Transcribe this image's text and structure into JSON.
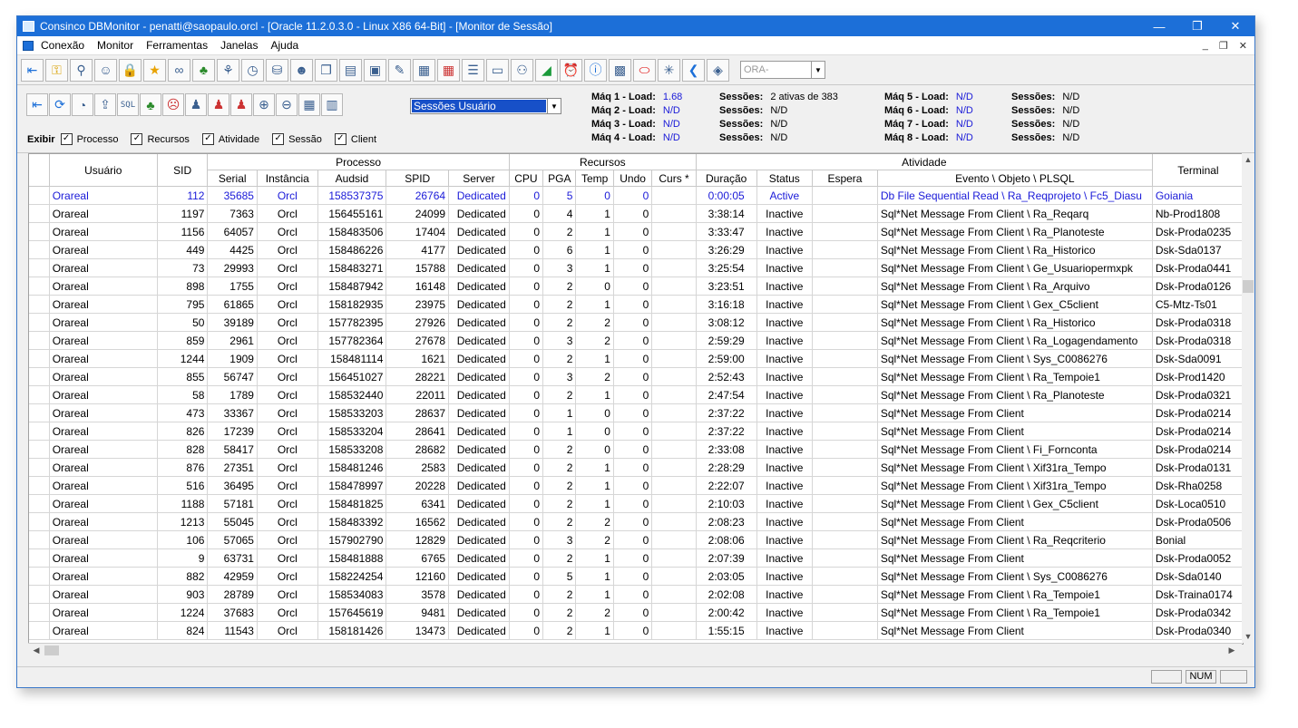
{
  "window": {
    "title": "Consinco DBMonitor - penatti@saopaulo.orcl - [Oracle 11.2.0.3.0 - Linux X86 64-Bit] - [Monitor de Sessão]"
  },
  "menu": [
    "Conexão",
    "Monitor",
    "Ferramentas",
    "Janelas",
    "Ajuda"
  ],
  "ora_combo": {
    "value": "ORA-"
  },
  "session_combo": {
    "value": "Sessões Usuário"
  },
  "exibir": {
    "label": "Exibir",
    "options": [
      "Processo",
      "Recursos",
      "Atividade",
      "Sessão",
      "Client"
    ]
  },
  "machines": [
    {
      "label": "Máq 1 - Load:",
      "value": "1.68",
      "sess_label": "Sessões:",
      "sess_value": "2 ativas de 383"
    },
    {
      "label": "Máq 2 - Load:",
      "value": "N/D",
      "sess_label": "Sessões:",
      "sess_value": "N/D"
    },
    {
      "label": "Máq 3 - Load:",
      "value": "N/D",
      "sess_label": "Sessões:",
      "sess_value": "N/D"
    },
    {
      "label": "Máq 4 - Load:",
      "value": "N/D",
      "sess_label": "Sessões:",
      "sess_value": "N/D"
    },
    {
      "label": "Máq 5 - Load:",
      "value": "N/D",
      "sess_label": "Sessões:",
      "sess_value": "N/D"
    },
    {
      "label": "Máq 6 - Load:",
      "value": "N/D",
      "sess_label": "Sessões:",
      "sess_value": "N/D"
    },
    {
      "label": "Máq 7 - Load:",
      "value": "N/D",
      "sess_label": "Sessões:",
      "sess_value": "N/D"
    },
    {
      "label": "Máq 8 - Load:",
      "value": "N/D",
      "sess_label": "Sessões:",
      "sess_value": "N/D"
    }
  ],
  "groups": {
    "processo": "Processo",
    "recursos": "Recursos",
    "atividade": "Atividade"
  },
  "columns": [
    "Usuário",
    "SID",
    "Serial",
    "Instância",
    "Audsid",
    "SPID",
    "Server",
    "CPU",
    "PGA",
    "Temp",
    "Undo",
    "Curs *",
    "Duração",
    "Status",
    "Espera",
    "Evento \\ Objeto \\ PLSQL",
    "Terminal"
  ],
  "rows": [
    [
      "Orareal",
      "112",
      "35685",
      "Orcl",
      "158537375",
      "26764",
      "Dedicated",
      "0",
      "5",
      "0",
      "0",
      "",
      "0:00:05",
      "Active",
      "",
      "Db File Sequential Read \\ Ra_Reqprojeto \\ Fc5_Diasu",
      "Goiania"
    ],
    [
      "Orareal",
      "1197",
      "7363",
      "Orcl",
      "156455161",
      "24099",
      "Dedicated",
      "0",
      "4",
      "1",
      "0",
      "",
      "3:38:14",
      "Inactive",
      "",
      "Sql*Net Message From Client \\ Ra_Reqarq",
      "Nb-Prod1808"
    ],
    [
      "Orareal",
      "1156",
      "64057",
      "Orcl",
      "158483506",
      "17404",
      "Dedicated",
      "0",
      "2",
      "1",
      "0",
      "",
      "3:33:47",
      "Inactive",
      "",
      "Sql*Net Message From Client \\ Ra_Planoteste",
      "Dsk-Proda0235"
    ],
    [
      "Orareal",
      "449",
      "4425",
      "Orcl",
      "158486226",
      "4177",
      "Dedicated",
      "0",
      "6",
      "1",
      "0",
      "",
      "3:26:29",
      "Inactive",
      "",
      "Sql*Net Message From Client \\ Ra_Historico",
      "Dsk-Sda0137"
    ],
    [
      "Orareal",
      "73",
      "29993",
      "Orcl",
      "158483271",
      "15788",
      "Dedicated",
      "0",
      "3",
      "1",
      "0",
      "",
      "3:25:54",
      "Inactive",
      "",
      "Sql*Net Message From Client \\ Ge_Usuariopermxpk",
      "Dsk-Proda0441"
    ],
    [
      "Orareal",
      "898",
      "1755",
      "Orcl",
      "158487942",
      "16148",
      "Dedicated",
      "0",
      "2",
      "0",
      "0",
      "",
      "3:23:51",
      "Inactive",
      "",
      "Sql*Net Message From Client \\ Ra_Arquivo",
      "Dsk-Proda0126"
    ],
    [
      "Orareal",
      "795",
      "61865",
      "Orcl",
      "158182935",
      "23975",
      "Dedicated",
      "0",
      "2",
      "1",
      "0",
      "",
      "3:16:18",
      "Inactive",
      "",
      "Sql*Net Message From Client \\ Gex_C5client",
      "C5-Mtz-Ts01"
    ],
    [
      "Orareal",
      "50",
      "39189",
      "Orcl",
      "157782395",
      "27926",
      "Dedicated",
      "0",
      "2",
      "2",
      "0",
      "",
      "3:08:12",
      "Inactive",
      "",
      "Sql*Net Message From Client \\ Ra_Historico",
      "Dsk-Proda0318"
    ],
    [
      "Orareal",
      "859",
      "2961",
      "Orcl",
      "157782364",
      "27678",
      "Dedicated",
      "0",
      "3",
      "2",
      "0",
      "",
      "2:59:29",
      "Inactive",
      "",
      "Sql*Net Message From Client \\ Ra_Logagendamento",
      "Dsk-Proda0318"
    ],
    [
      "Orareal",
      "1244",
      "1909",
      "Orcl",
      "158481114",
      "1621",
      "Dedicated",
      "0",
      "2",
      "1",
      "0",
      "",
      "2:59:00",
      "Inactive",
      "",
      "Sql*Net Message From Client \\ Sys_C0086276",
      "Dsk-Sda0091"
    ],
    [
      "Orareal",
      "855",
      "56747",
      "Orcl",
      "156451027",
      "28221",
      "Dedicated",
      "0",
      "3",
      "2",
      "0",
      "",
      "2:52:43",
      "Inactive",
      "",
      "Sql*Net Message From Client \\ Ra_Tempoie1",
      "Dsk-Prod1420"
    ],
    [
      "Orareal",
      "58",
      "1789",
      "Orcl",
      "158532440",
      "22011",
      "Dedicated",
      "0",
      "2",
      "1",
      "0",
      "",
      "2:47:54",
      "Inactive",
      "",
      "Sql*Net Message From Client \\ Ra_Planoteste",
      "Dsk-Proda0321"
    ],
    [
      "Orareal",
      "473",
      "33367",
      "Orcl",
      "158533203",
      "28637",
      "Dedicated",
      "0",
      "1",
      "0",
      "0",
      "",
      "2:37:22",
      "Inactive",
      "",
      "Sql*Net Message From Client",
      "Dsk-Proda0214"
    ],
    [
      "Orareal",
      "826",
      "17239",
      "Orcl",
      "158533204",
      "28641",
      "Dedicated",
      "0",
      "1",
      "0",
      "0",
      "",
      "2:37:22",
      "Inactive",
      "",
      "Sql*Net Message From Client",
      "Dsk-Proda0214"
    ],
    [
      "Orareal",
      "828",
      "58417",
      "Orcl",
      "158533208",
      "28682",
      "Dedicated",
      "0",
      "2",
      "0",
      "0",
      "",
      "2:33:08",
      "Inactive",
      "",
      "Sql*Net Message From Client \\ Fi_Fornconta",
      "Dsk-Proda0214"
    ],
    [
      "Orareal",
      "876",
      "27351",
      "Orcl",
      "158481246",
      "2583",
      "Dedicated",
      "0",
      "2",
      "1",
      "0",
      "",
      "2:28:29",
      "Inactive",
      "",
      "Sql*Net Message From Client \\ Xif31ra_Tempo",
      "Dsk-Proda0131"
    ],
    [
      "Orareal",
      "516",
      "36495",
      "Orcl",
      "158478997",
      "20228",
      "Dedicated",
      "0",
      "2",
      "1",
      "0",
      "",
      "2:22:07",
      "Inactive",
      "",
      "Sql*Net Message From Client \\ Xif31ra_Tempo",
      "Dsk-Rha0258"
    ],
    [
      "Orareal",
      "1188",
      "57181",
      "Orcl",
      "158481825",
      "6341",
      "Dedicated",
      "0",
      "2",
      "1",
      "0",
      "",
      "2:10:03",
      "Inactive",
      "",
      "Sql*Net Message From Client \\ Gex_C5client",
      "Dsk-Loca0510"
    ],
    [
      "Orareal",
      "1213",
      "55045",
      "Orcl",
      "158483392",
      "16562",
      "Dedicated",
      "0",
      "2",
      "2",
      "0",
      "",
      "2:08:23",
      "Inactive",
      "",
      "Sql*Net Message From Client",
      "Dsk-Proda0506"
    ],
    [
      "Orareal",
      "106",
      "57065",
      "Orcl",
      "157902790",
      "12829",
      "Dedicated",
      "0",
      "3",
      "2",
      "0",
      "",
      "2:08:06",
      "Inactive",
      "",
      "Sql*Net Message From Client \\ Ra_Reqcriterio",
      "Bonial"
    ],
    [
      "Orareal",
      "9",
      "63731",
      "Orcl",
      "158481888",
      "6765",
      "Dedicated",
      "0",
      "2",
      "1",
      "0",
      "",
      "2:07:39",
      "Inactive",
      "",
      "Sql*Net Message From Client",
      "Dsk-Proda0052"
    ],
    [
      "Orareal",
      "882",
      "42959",
      "Orcl",
      "158224254",
      "12160",
      "Dedicated",
      "0",
      "5",
      "1",
      "0",
      "",
      "2:03:05",
      "Inactive",
      "",
      "Sql*Net Message From Client \\ Sys_C0086276",
      "Dsk-Sda0140"
    ],
    [
      "Orareal",
      "903",
      "28789",
      "Orcl",
      "158534083",
      "3578",
      "Dedicated",
      "0",
      "2",
      "1",
      "0",
      "",
      "2:02:08",
      "Inactive",
      "",
      "Sql*Net Message From Client \\ Ra_Tempoie1",
      "Dsk-Traina0174"
    ],
    [
      "Orareal",
      "1224",
      "37683",
      "Orcl",
      "157645619",
      "9481",
      "Dedicated",
      "0",
      "2",
      "2",
      "0",
      "",
      "2:00:42",
      "Inactive",
      "",
      "Sql*Net Message From Client \\ Ra_Tempoie1",
      "Dsk-Proda0342"
    ],
    [
      "Orareal",
      "824",
      "11543",
      "Orcl",
      "158181426",
      "13473",
      "Dedicated",
      "0",
      "2",
      "1",
      "0",
      "",
      "1:55:15",
      "Inactive",
      "",
      "Sql*Net Message From Client",
      "Dsk-Proda0340"
    ]
  ],
  "statusbar": {
    "num": "NUM"
  },
  "icons": {
    "toolbar1": [
      "exit-icon",
      "key-icon",
      "key-gray-icon",
      "user-key-icon",
      "lock-icon",
      "star-icon",
      "glasses-icon",
      "users-icon",
      "search-users-icon",
      "clock-icon",
      "database-icon",
      "group-icon",
      "copy-icon",
      "document-icon",
      "report-icon",
      "edit-report-icon",
      "table-icon",
      "table-red-icon",
      "list-icon",
      "monitor-icon",
      "people-icon",
      "chart-icon",
      "alarm-icon",
      "info-icon",
      "calculator-icon",
      "oracle-icon",
      "star-burst-icon",
      "back-icon",
      "book-icon"
    ],
    "toolbar2": [
      "exit-icon",
      "refresh-icon",
      "timer-icon",
      "export-icon",
      "sql-icon",
      "users-icon",
      "user-remove-icon",
      "user-icon",
      "user-minus-icon",
      "user-stop-icon",
      "zoom-in-icon",
      "zoom-out-icon",
      "calendar-icon",
      "grid-icon"
    ]
  },
  "colors": {
    "titlebar": "#1c6fd8",
    "active_row": "#1a1ad8",
    "selection": "#1750c8"
  }
}
